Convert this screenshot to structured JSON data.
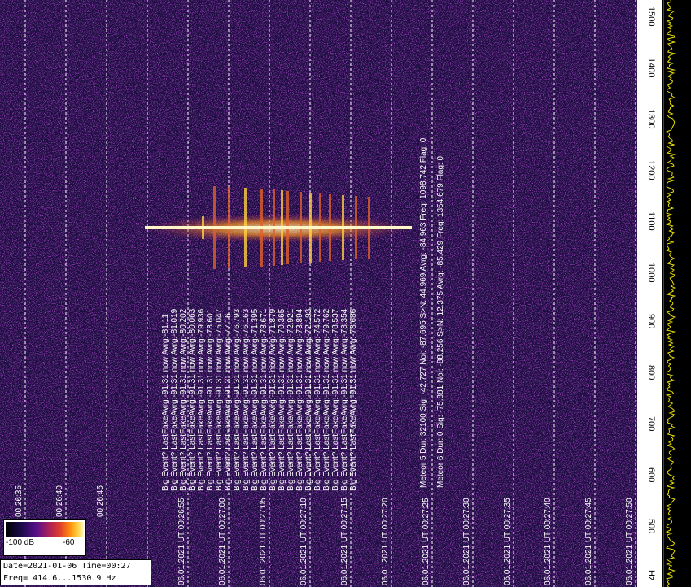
{
  "colors": {
    "background": "#1b0d3f",
    "event_core": "#fff6c8",
    "grid": "#ffffff",
    "trace": "#e8e000"
  },
  "time_axis": {
    "top_labels": [
      "00:26:35",
      "00:26:40",
      "00:26:45"
    ],
    "bottom_labels": [
      "06.01.2021  UT 00:26:55",
      "06.01.2021  UT 00:27:00",
      "06.01.2021  UT 00:27:05",
      "06.01.2021  UT 00:27:10",
      "06.01.2021  UT 00:27:15",
      "06.01.2021  UT 00:27:20",
      "06.01.2021  UT 00:27:25",
      "06.01.2021  UT 00:27:30",
      "06.01.2021  UT 00:27:35",
      "06.01.2021  UT 00:27:40",
      "06.01.2021  UT 00:27:45",
      "06.01.2021  UT 00:27:50"
    ]
  },
  "freq_axis": {
    "labels": [
      "1500",
      "1400",
      "1300",
      "1200",
      "1100",
      "1000",
      "900",
      "800",
      "700",
      "600",
      "500",
      "Hz"
    ]
  },
  "events": [
    "Big Event? LastFakeAvrg:-91.31 now Avrg:-81.11",
    "Big Event? LastFakeAvrg:-91.31 now Avrg:-81.019",
    "Big Event? LastFakeAvrg:-91.31 now Avrg:-80.202",
    "Big Event? LastFakeAvrg:-91.31 now Avrg:-80.063",
    "Big Event? LastFakeAvrg:-91.31 now Avrg:-79.936",
    "Big Event? LastFakeAvrg:-91.31 now Avrg:-78.601",
    "Big Event? LastFakeAvrg:-91.31 now Avrg:-75.047",
    "Big Event? LastFakeAvrg:-91.31 now Avrg:-77.16",
    "Big Event? LastFakeAvrg:-91.31 now Avrg:-76.793",
    "Big Event? LastFakeAvrg:-91.31 now Avrg:-76.163",
    "Big Event? LastFakeAvrg:-91.31 now Avrg:-71.395",
    "Big Event? LastFakeAvrg:-91.31 now Avrg:-78.671",
    "Big Event? LastFakeAvrg:-91.31 now Avrg:-71.879",
    "Big Event? LastFakeAvrg:-91.31 now Avrg:-70.365",
    "Big Event? LastFakeAvrg:-91.31 now Avrg:-72.921",
    "Big Event? LastFakeAvrg:-91.31 now Avrg:-73.894",
    "Big Event? LastFakeAvrg:-91.31 now Avrg:-72.193",
    "Big Event? LastFakeAvrg:-91.31 now Avrg:-74.572",
    "Big Event? LastFakeAvrg:-91.31 now Avrg:-79.762",
    "Big Event? LastFakeAvrg:-91.31 now Avrg:-78.537",
    "Big Event? LastFakeAvrg:-91.31 now Avrg:-78.354",
    "Big Event? LastFakeAvrg:-91.31 now Avrg:-78.686"
  ],
  "meteors": [
    "Meteor  5  Dur:  32100   Sig: -42.727   Noi: -87.695   S>N: 44.969   Avrg: -84.963   Freq: 1098.742   Flag:  0",
    "Meteor  6  Dur:  0   Sig: -75.881   Noi: -88.256   S>N: 12.375   Avrg: -85.429   Freq: 1354.679   Flag:  0"
  ],
  "colorbar": {
    "min_label": "-100 dB",
    "max_label": "-60"
  },
  "info": {
    "date_time": "Date=2021-01-06 Time=00:27",
    "freq": "Freq= 414.6...1530.9 Hz"
  }
}
